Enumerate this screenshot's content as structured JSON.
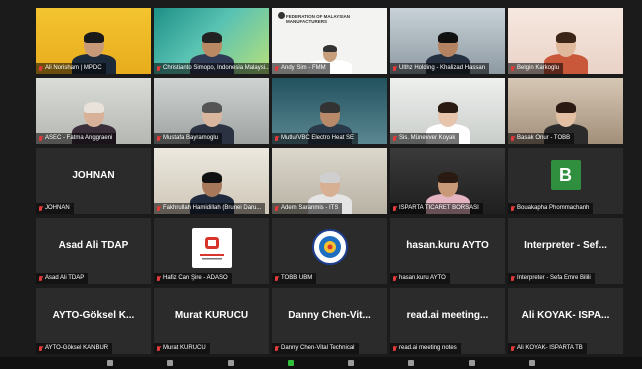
{
  "meeting": {
    "participants": [
      {
        "name": "Ali Norisham | MPDC",
        "type": "video",
        "scene": "bg-yellow",
        "active": false
      },
      {
        "name": "Christianto Simopo, Indonesia Malaysi...",
        "type": "video",
        "scene": "bg-teal",
        "active": true
      },
      {
        "name": "Andy Sim - FMM",
        "type": "video",
        "scene": "bg-white-doc",
        "doc_title": "FEDERATION OF MALAYSIAN MANUFACTURERS",
        "active": false
      },
      {
        "name": "Ulthz Holding - Khalizad Hassan",
        "type": "video",
        "scene": "bg-window",
        "active": false
      },
      {
        "name": "Belgin Karkoglu",
        "type": "video",
        "scene": "bg-bright",
        "active": false
      },
      {
        "name": "ASEC - Fatma Anggraeni",
        "type": "video",
        "scene": "bg-office",
        "active": false
      },
      {
        "name": "Mustafa Bayramoglu",
        "type": "video",
        "scene": "bg-room",
        "active": false
      },
      {
        "name": "Mutlu/VBC Electro Heat SE",
        "type": "video",
        "scene": "bg-teal2",
        "active": false
      },
      {
        "name": "Sis. Münevver Koyak",
        "type": "video",
        "scene": "bg-lightgray",
        "active": false
      },
      {
        "name": "Basak Onur - TOBB",
        "type": "video",
        "scene": "bg-warm",
        "active": false
      },
      {
        "name": "JOHNAN",
        "type": "name",
        "display": "JOHNAN",
        "active": false
      },
      {
        "name": "Fakhrullah Hamidillah (Brunei Daru...",
        "type": "video",
        "scene": "bg-cream",
        "active": false
      },
      {
        "name": "Adem Saranmis - ITS",
        "type": "video",
        "scene": "bg-beige",
        "active": false
      },
      {
        "name": "ISPARTA TICARET BORSASI",
        "type": "video",
        "scene": "bg-dark",
        "active": false
      },
      {
        "name": "Bouakapha Phommachanh",
        "type": "avatar",
        "initial": "B",
        "active": false
      },
      {
        "name": "Asad Ali TDAP",
        "type": "name",
        "display": "Asad Ali TDAP",
        "active": false
      },
      {
        "name": "Hafiz Can Şire - ADASO",
        "type": "logo",
        "logo": "adaso",
        "active": false
      },
      {
        "name": "TOBB UBM",
        "type": "logo",
        "logo": "tobb",
        "active": false
      },
      {
        "name": "hasan.kuru AYTO",
        "type": "name",
        "display": "hasan.kuru AYTO",
        "active": false
      },
      {
        "name": "Interpreter - Sefa Emre Bilili",
        "type": "name",
        "display": "Interpreter - Sef...",
        "active": false
      },
      {
        "name": "AYTO-Göksel KANBUR",
        "type": "name",
        "display": "AYTO-Göksel K...",
        "active": false
      },
      {
        "name": "Murat KURUCU",
        "type": "name",
        "display": "Murat KURUCU",
        "active": false
      },
      {
        "name": "Danny Chen-Vital Technical",
        "type": "name",
        "display": "Danny Chen-Vit...",
        "active": false
      },
      {
        "name": "read.ai meeting notes",
        "type": "name",
        "display": "read.ai meeting...",
        "active": false
      },
      {
        "name": "Ali KOYAK- ISPARTA TB",
        "type": "name",
        "display": "Ali KOYAK- ISPA...",
        "active": false
      }
    ]
  },
  "colors": {
    "active_border": "#9ccc3a",
    "muted_mic": "#e23b3b",
    "avatar_green": "#2f8f3f",
    "tile_bg": "#2b2b2b"
  },
  "toolbar": {
    "icons": [
      "mic-icon",
      "video-icon",
      "participants-icon",
      "share-icon",
      "record-icon",
      "reactions-icon",
      "apps-icon",
      "more-icon"
    ]
  }
}
